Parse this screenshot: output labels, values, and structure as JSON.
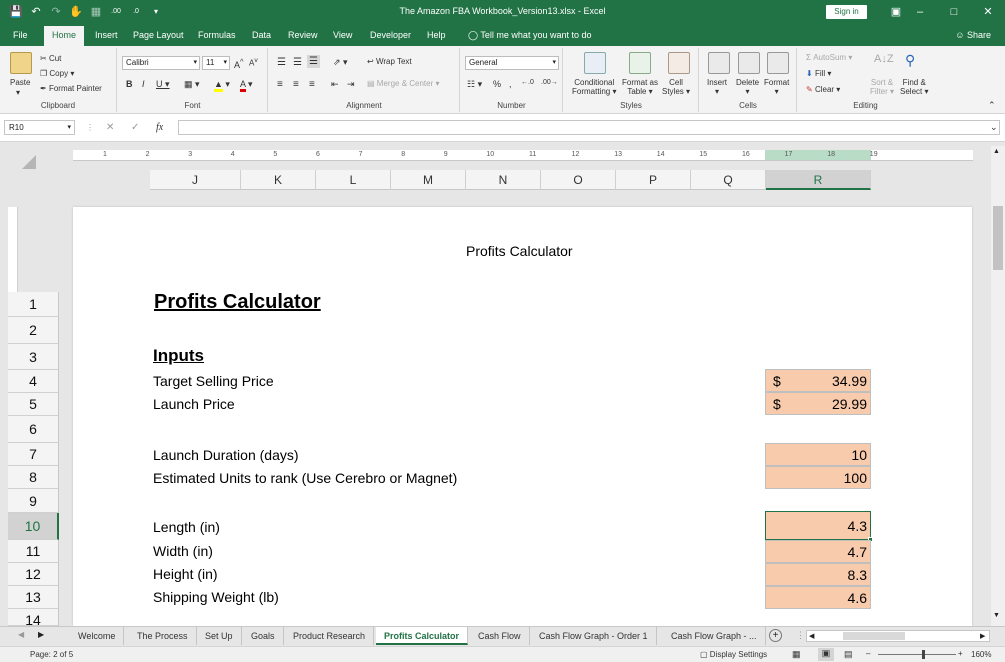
{
  "window": {
    "title": "The Amazon FBA Workbook_Version13.xlsx  -  Excel",
    "sign_in": "Sign in"
  },
  "ribbon_tabs": [
    "File",
    "Home",
    "Insert",
    "Page Layout",
    "Formulas",
    "Data",
    "Review",
    "View",
    "Developer",
    "Help"
  ],
  "tell_me": "Tell me what you want to do",
  "share": "Share",
  "ribbon": {
    "clipboard": {
      "paste": "Paste",
      "cut": "Cut",
      "copy": "Copy",
      "format_painter": "Format Painter",
      "label": "Clipboard"
    },
    "font": {
      "name": "Calibri",
      "size": "11",
      "label": "Font"
    },
    "alignment": {
      "wrap_text": "Wrap Text",
      "merge_center": "Merge & Center",
      "label": "Alignment"
    },
    "number": {
      "format": "General",
      "label": "Number"
    },
    "styles": {
      "conditional": "Conditional",
      "formatting": "Formatting",
      "format_as": "Format as",
      "table": "Table",
      "cell": "Cell",
      "cell_styles": "Styles",
      "label": "Styles"
    },
    "cells": {
      "insert": "Insert",
      "delete": "Delete",
      "format": "Format",
      "label": "Cells"
    },
    "editing": {
      "autosum": "AutoSum",
      "fill": "Fill",
      "clear": "Clear",
      "sort": "Sort &",
      "filter": "Filter",
      "find": "Find &",
      "select": "Select",
      "label": "Editing"
    }
  },
  "name_box": "R10",
  "columns": [
    "J",
    "K",
    "L",
    "M",
    "N",
    "O",
    "P",
    "Q",
    "R"
  ],
  "selected_column": "R",
  "selected_row": "10",
  "rows": [
    "1",
    "2",
    "3",
    "4",
    "5",
    "6",
    "7",
    "8",
    "9",
    "10",
    "11",
    "12",
    "13",
    "14"
  ],
  "ruler_numbers": [
    "1",
    "2",
    "3",
    "4",
    "5",
    "6",
    "7",
    "8",
    "9",
    "10",
    "11",
    "12",
    "13",
    "14",
    "15",
    "16",
    "17",
    "18",
    "19"
  ],
  "sheet": {
    "header_text": "Profits Calculator",
    "title": "Profits Calculator",
    "inputs_heading": "Inputs",
    "target_selling_price": {
      "label": "Target Selling Price",
      "currency": "$",
      "value": "34.99"
    },
    "launch_price": {
      "label": "Launch Price",
      "currency": "$",
      "value": "29.99"
    },
    "launch_duration": {
      "label": "Launch Duration (days)",
      "value": "10"
    },
    "estimated_units": {
      "label": "Estimated Units to rank (Use Cerebro or Magnet)",
      "value": "100"
    },
    "length": {
      "label": "Length (in)",
      "value": "4.3"
    },
    "width": {
      "label": "Width (in)",
      "value": "4.7"
    },
    "height": {
      "label": "Height (in)",
      "value": "8.3"
    },
    "shipping_weight": {
      "label": "Shipping Weight (lb)",
      "value": "4.6"
    }
  },
  "sheet_tabs": [
    "Welcome",
    "The Process",
    "Set Up",
    "Goals",
    "Product Research",
    "Profits Calculator",
    "Cash Flow",
    "Cash Flow Graph - Order 1",
    "Cash Flow Graph - ..."
  ],
  "active_sheet_tab": "Profits Calculator",
  "status": {
    "page": "Page: 2 of 5",
    "display_settings": "Display Settings",
    "zoom": "160%"
  },
  "colors": {
    "excel_green": "#217346",
    "input_fill": "#f8cbad"
  }
}
